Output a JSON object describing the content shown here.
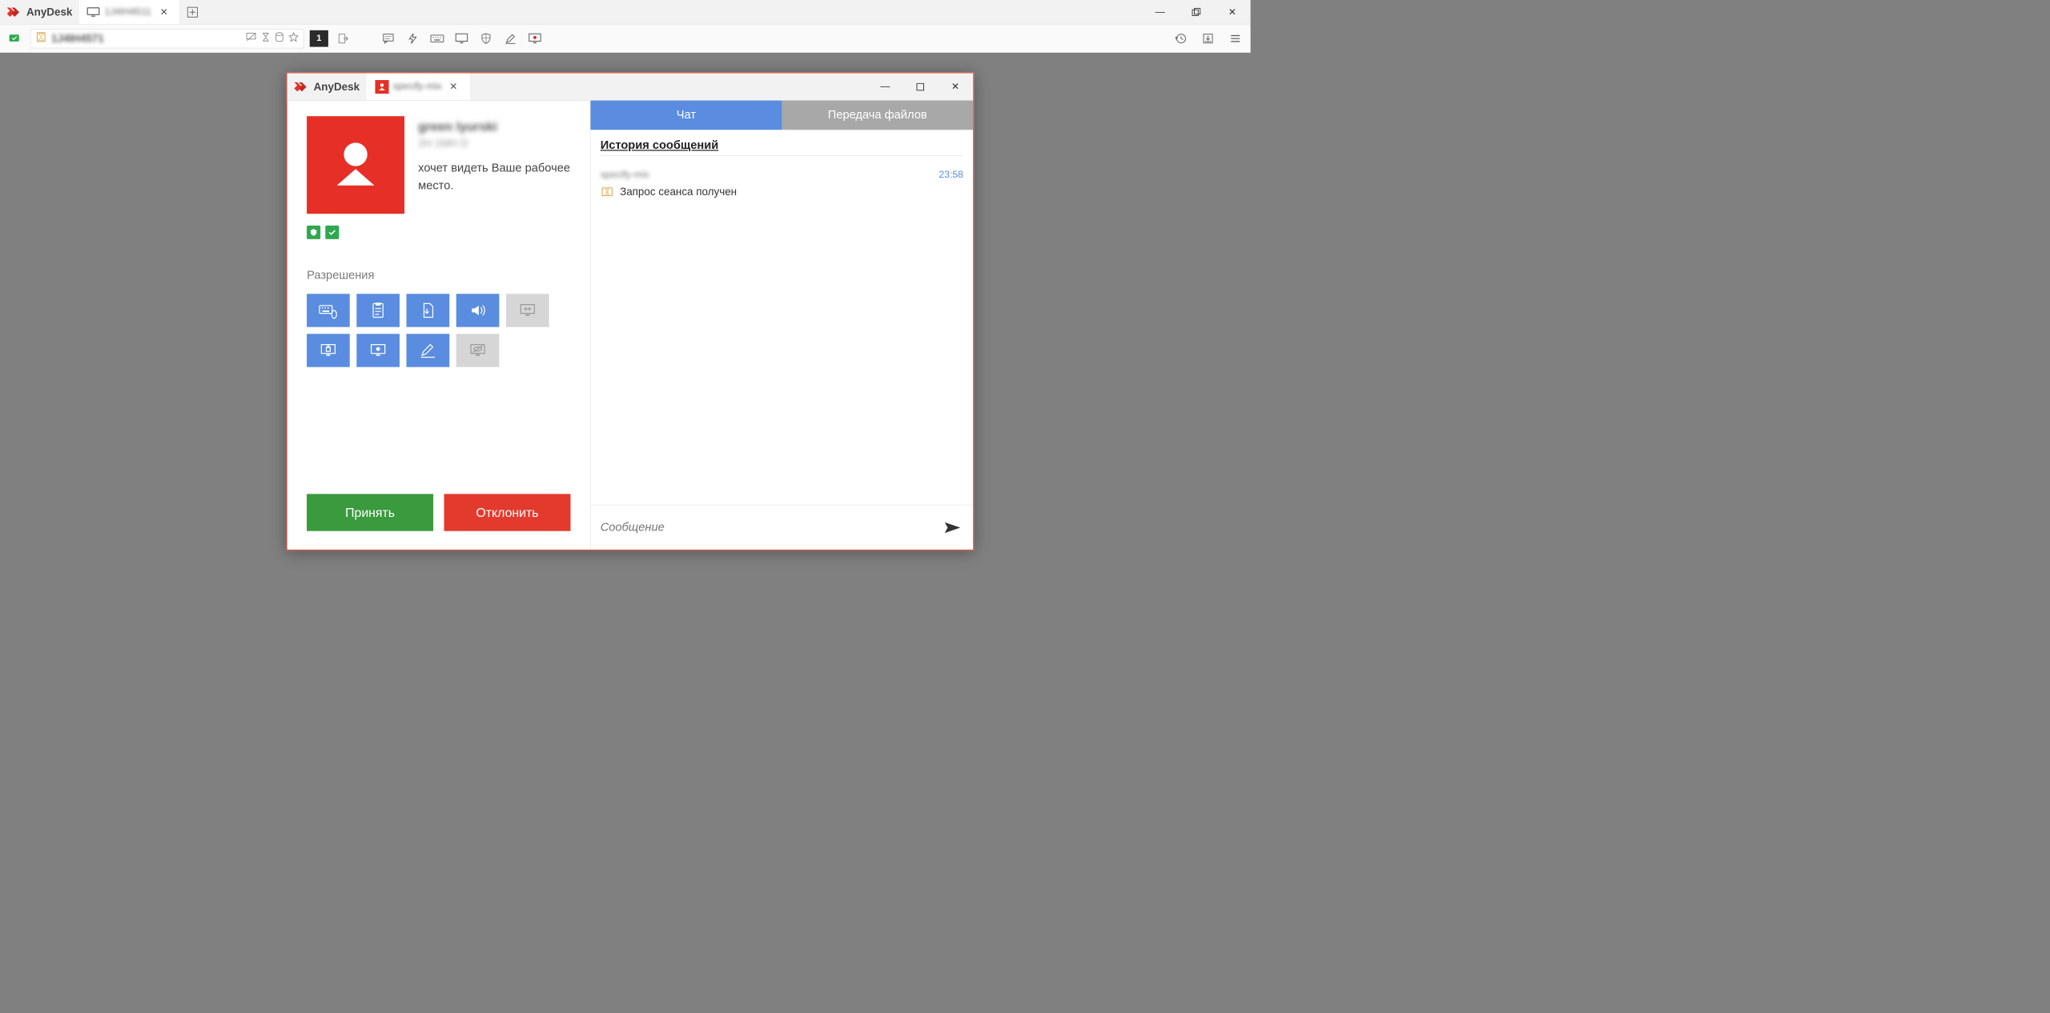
{
  "main": {
    "brand": "AnyDesk",
    "tab_label": "1J4IH4511",
    "address": "1J4IH4571",
    "badge_count": "1"
  },
  "dialog": {
    "brand": "AnyDesk",
    "tab_label": "specify-mix",
    "requester_name": "green lyurski",
    "requester_id": "2H 1MH D",
    "request_text": "хочет видеть Ваше рабочее место.",
    "permissions_title": "Разрешения",
    "accept_label": "Принять",
    "reject_label": "Отклонить"
  },
  "chat": {
    "tab_chat": "Чат",
    "tab_files": "Передача файлов",
    "history_header": "История сообщений",
    "msg_sender": "specify-mix",
    "msg_time": "23:58",
    "msg_text": "Запрос сеанса получен",
    "compose_placeholder": "Сообщение"
  }
}
